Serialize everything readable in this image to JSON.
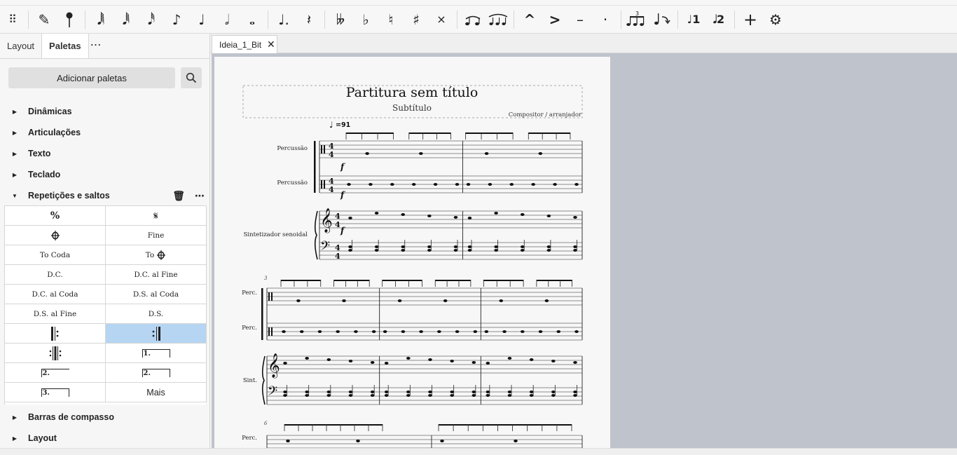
{
  "toolbar": {
    "icons": [
      "drag-handle-icon",
      "pencil-icon",
      "pin-icon",
      "64th-note-icon",
      "32nd-note-icon",
      "16th-note-icon",
      "eighth-note-icon",
      "quarter-note-icon",
      "half-note-icon",
      "whole-note-icon",
      "dotted-note-icon",
      "rest-icon",
      "double-flat-icon",
      "flat-icon",
      "natural-icon",
      "sharp-icon",
      "double-sharp-icon",
      "tie-icon",
      "slur-icon",
      "marcato-icon",
      "accent-icon",
      "tenuto-icon",
      "staccato-icon",
      "tuplet-icon",
      "flip-icon",
      "voice-1-icon",
      "voice-2-icon",
      "add-icon",
      "settings-icon"
    ]
  },
  "left_panel": {
    "tabs": [
      {
        "label": "Layout",
        "active": false
      },
      {
        "label": "Paletas",
        "active": true
      }
    ],
    "tab_more": "⋯",
    "add_palettes_label": "Adicionar paletas",
    "categories_top": [
      "Dinâmicas",
      "Articulações",
      "Texto",
      "Teclado"
    ],
    "expanded_category": "Repetições e saltos",
    "categories_bottom": [
      "Barras de compasso",
      "Layout"
    ],
    "repeat_cells": [
      {
        "label": "%",
        "kind": "symbol"
      },
      {
        "label": "𝄋",
        "kind": "symbol"
      },
      {
        "label": "⌖",
        "kind": "coda"
      },
      {
        "label": "Fine",
        "kind": "text"
      },
      {
        "label": "To Coda",
        "kind": "text"
      },
      {
        "label": "To ⌖",
        "kind": "text"
      },
      {
        "label": "D.C.",
        "kind": "text"
      },
      {
        "label": "D.C. al Fine",
        "kind": "text"
      },
      {
        "label": "D.C. al Coda",
        "kind": "text"
      },
      {
        "label": "D.S. al Coda",
        "kind": "text"
      },
      {
        "label": "D.S. al Fine",
        "kind": "text"
      },
      {
        "label": "D.S.",
        "kind": "text"
      },
      {
        "label": "start-repeat",
        "kind": "barline"
      },
      {
        "label": "end-repeat",
        "kind": "barline",
        "selected": true
      },
      {
        "label": "end-start-repeat",
        "kind": "barline"
      },
      {
        "label": "1.",
        "kind": "volta"
      },
      {
        "label": "2.",
        "kind": "volta"
      },
      {
        "label": "2.",
        "kind": "volta"
      },
      {
        "label": "3.",
        "kind": "volta"
      },
      {
        "label": "Mais",
        "kind": "more"
      }
    ]
  },
  "document": {
    "tab_label": "Ideia_1_Bit",
    "title": "Partitura sem título",
    "subtitle": "Subtítulo",
    "composer": "Compositor / arranjador",
    "tempo": "=91",
    "dynamic": "f",
    "system1_labels": [
      "Percussão",
      "Percussão",
      "Sintetizador senoidal"
    ],
    "system2_labels": [
      "Perc.",
      "Perc.",
      "Sint."
    ],
    "system3_labels": [
      "Perc."
    ],
    "measure_numbers": [
      "3",
      "6"
    ]
  },
  "colors": {
    "selection": "#b6d5f2",
    "canvas_bg": "#bfc3cb",
    "page_bg": "#f7f7f7"
  }
}
